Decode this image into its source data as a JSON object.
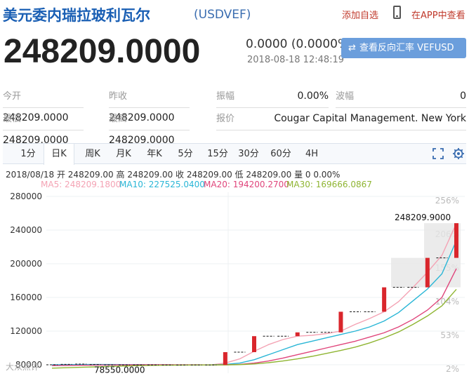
{
  "header": {
    "title": "美元委内瑞拉玻利瓦尔",
    "code": "(USDVEF)",
    "add_fav": "添加自选",
    "app_view": "在APP中查看"
  },
  "quote": {
    "price": "248209.0000",
    "change": "0.0000 (0.0000%)",
    "timestamp": "2018-08-18 12:48:19",
    "reverse_button": "查看反向汇率 VEFUSD"
  },
  "stats": [
    {
      "label": "今开",
      "value": "248209.0000"
    },
    {
      "label": "昨收",
      "value": "248209.0000"
    },
    {
      "label": "振幅",
      "value": "0.00%"
    },
    {
      "label": "波幅",
      "value": "0"
    },
    {
      "label": "最低",
      "value": "248209.0000"
    },
    {
      "label": "最高",
      "value": "248209.0000"
    },
    {
      "label": "报价",
      "value": "Cougar Capital Management. New York"
    }
  ],
  "tabs": [
    "1分",
    "日K",
    "周K",
    "月K",
    "年K",
    "5分",
    "15分",
    "30分",
    "60分",
    "4H"
  ],
  "active_tab": "日K",
  "ohlc_line": "2018/08/18 开 248209.00 高 248209.00 收 248209.00 低 248209.00 量 0 0.00%",
  "ma": [
    {
      "label": "MA5: 248209.1800",
      "color": "#f4a3b4"
    },
    {
      "label": "MA10: 227525.0400",
      "color": "#29b6d6"
    },
    {
      "label": "MA20: 194200.2700",
      "color": "#e0457b"
    },
    {
      "label": "MA30: 169666.0867",
      "color": "#8fb532"
    }
  ],
  "colors": {
    "up_candle": "#d9262c",
    "accent": "#1a5fb4",
    "button": "#6b9edc"
  },
  "chart_data": {
    "type": "candlestick",
    "y_ticks": [
      "280000",
      "240000",
      "200000",
      "160000",
      "120000",
      "80000"
    ],
    "y_min": 70000,
    "y_max": 285000,
    "right_ticks": [
      "256%",
      "206%",
      "155%",
      "104%",
      "53%",
      "2%"
    ],
    "max_label": "248209.9000",
    "min_label": "78550.0000",
    "grid": true,
    "candles": [
      {
        "x": 0.0,
        "o": 80000,
        "c": 80000
      },
      {
        "x": 0.05,
        "o": 80500,
        "c": 80500
      },
      {
        "x": 0.1,
        "o": 80800,
        "c": 80800
      },
      {
        "x": 0.15,
        "o": 80200,
        "c": 80200
      },
      {
        "x": 0.2,
        "o": 79800,
        "c": 79800
      },
      {
        "x": 0.25,
        "o": 79800,
        "c": 79800
      },
      {
        "x": 0.3,
        "o": 79800,
        "c": 79800
      },
      {
        "x": 0.35,
        "o": 79800,
        "c": 79800
      },
      {
        "x": 0.4,
        "o": 79800,
        "c": 79800
      },
      {
        "x": 0.45,
        "o": 79800,
        "c": 79800
      },
      {
        "x": 0.5,
        "o": 79800,
        "c": 79800
      },
      {
        "x": 0.55,
        "o": 79800,
        "c": 79800
      },
      {
        "x": 0.6,
        "o": 79800,
        "c": 95000
      },
      {
        "x": 0.65,
        "o": 95000,
        "c": 95000
      },
      {
        "x": 0.7,
        "o": 95000,
        "c": 114000
      },
      {
        "x": 0.75,
        "o": 114000,
        "c": 114000
      },
      {
        "x": 0.8,
        "o": 114000,
        "c": 114000
      },
      {
        "x": 0.85,
        "o": 114000,
        "c": 118500
      },
      {
        "x": 0.9,
        "o": 118500,
        "c": 118500
      },
      {
        "x": 0.95,
        "o": 118500,
        "c": 118500
      },
      {
        "x": 1.0,
        "o": 118500,
        "c": 143000
      },
      {
        "x": 1.05,
        "o": 143000,
        "c": 143000
      },
      {
        "x": 1.1,
        "o": 143000,
        "c": 143000
      },
      {
        "x": 1.15,
        "o": 143000,
        "c": 172000
      },
      {
        "x": 1.2,
        "o": 172000,
        "c": 172000
      },
      {
        "x": 1.25,
        "o": 172000,
        "c": 172000
      },
      {
        "x": 1.3,
        "o": 172000,
        "c": 207000
      },
      {
        "x": 1.35,
        "o": 207000,
        "c": 207000
      },
      {
        "x": 1.4,
        "o": 207000,
        "c": 248209
      }
    ],
    "ma_series": [
      {
        "name": "MA5",
        "values": [
          80000,
          80200,
          80400,
          80400,
          80200,
          80000,
          79800,
          79800,
          79800,
          79800,
          79800,
          79800,
          82000,
          87000,
          96000,
          104000,
          110000,
          114000,
          115000,
          117000,
          120000,
          128000,
          135000,
          143000,
          155000,
          172000,
          190000,
          210000,
          248000
        ]
      },
      {
        "name": "MA10",
        "values": [
          80000,
          80100,
          80300,
          80400,
          80400,
          80300,
          80200,
          80000,
          79900,
          79800,
          79800,
          79800,
          80500,
          82000,
          86000,
          92000,
          98000,
          104000,
          108000,
          112000,
          116000,
          120000,
          125000,
          132000,
          142000,
          156000,
          170000,
          188000,
          227525
        ]
      },
      {
        "name": "MA20",
        "values": [
          79000,
          79200,
          79400,
          79600,
          79800,
          79900,
          80000,
          80000,
          80000,
          79900,
          79900,
          79800,
          80000,
          80500,
          82000,
          84500,
          88000,
          92000,
          96000,
          100000,
          104000,
          108000,
          113000,
          118000,
          125000,
          134000,
          145000,
          160000,
          194200
        ]
      },
      {
        "name": "MA30",
        "values": [
          76000,
          76500,
          77000,
          77500,
          78000,
          78500,
          79000,
          79300,
          79500,
          79600,
          79700,
          79800,
          79900,
          80200,
          81000,
          82500,
          84500,
          87000,
          90000,
          93500,
          97000,
          101000,
          106000,
          112000,
          119000,
          128000,
          138000,
          150000,
          169666
        ]
      }
    ]
  },
  "watermark": "大众点评"
}
